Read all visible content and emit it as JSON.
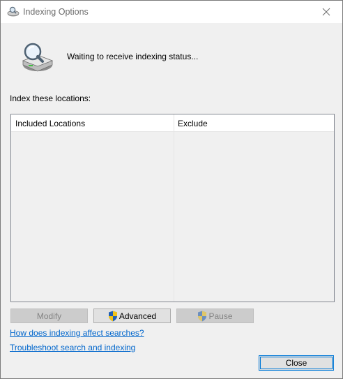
{
  "window": {
    "title": "Indexing Options"
  },
  "status": {
    "text": "Waiting to receive indexing status..."
  },
  "locations": {
    "label": "Index these locations:",
    "columns": [
      "Included Locations",
      "Exclude"
    ],
    "rows": []
  },
  "buttons": {
    "modify": "Modify",
    "advanced": "Advanced",
    "pause": "Pause",
    "close": "Close"
  },
  "links": {
    "how_indexing": "How does indexing affect searches?",
    "troubleshoot": "Troubleshoot search and indexing"
  },
  "colors": {
    "link": "#0066cc",
    "default_button_border": "#0078d7",
    "window_bg": "#f0f0f0"
  }
}
